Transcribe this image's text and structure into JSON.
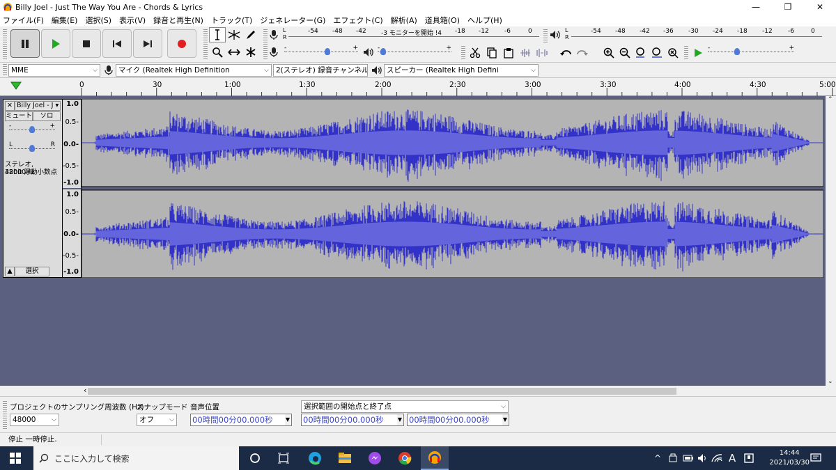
{
  "window": {
    "title": "Billy Joel - Just The Way You Are - Chords & Lyrics",
    "minimize": "—",
    "restore": "❐",
    "close": "✕"
  },
  "menu": [
    "ファイル(F)",
    "編集(E)",
    "選択(S)",
    "表示(V)",
    "録音と再生(N)",
    "トラック(T)",
    "ジェネレーター(G)",
    "エフェクト(C)",
    "解析(A)",
    "道具箱(O)",
    "ヘルプ(H)"
  ],
  "meters": {
    "record_scale": [
      "-54",
      "-48",
      "-42",
      "-3 モニターを開始 !4",
      "-18",
      "-12",
      "-6",
      "0"
    ],
    "play_scale": [
      "-54",
      "-48",
      "-42",
      "-36",
      "-30",
      "-24",
      "-18",
      "-12",
      "-6",
      "0"
    ],
    "lr": [
      "L",
      "R"
    ]
  },
  "sliders": {
    "plus": "+",
    "minus": "-"
  },
  "device": {
    "host": "MME",
    "mic": "マイク (Realtek High Definition",
    "channels": "2(ステレオ) 録音チャンネル",
    "speaker": "スピーカー (Realtek High Defini"
  },
  "ruler": [
    "0",
    "30",
    "1:00",
    "1:30",
    "2:00",
    "2:30",
    "3:00",
    "3:30",
    "4:00",
    "4:30",
    "5:00"
  ],
  "track": {
    "name": "Billy Joel - J",
    "mute": "ミュート",
    "solo": "ソロ",
    "gain_minus": "-",
    "gain_plus": "+",
    "pan_l": "L",
    "pan_r": "R",
    "info_line1": "ステレオ, 48000Hz",
    "info_line2": "32bit 浮動小数点",
    "select": "選択",
    "scale": [
      "1.0",
      "0.5-",
      "0.0-",
      "-0.5-",
      "-1.0"
    ]
  },
  "selection": {
    "rate_label": "プロジェクトのサンプリング周波数 (Hz)",
    "rate_value": "48000",
    "snap_label": "スナップモード",
    "snap_value": "オフ",
    "pos_label": "音声位置",
    "pos_value": "00時間00分00.000秒",
    "range_label": "選択範囲の開始点と終了点",
    "start_value": "00時間00分00.000秒",
    "end_value": "00時間00分00.000秒"
  },
  "status": "停止 一時停止.",
  "taskbar": {
    "search_placeholder": "ここに入力して検索",
    "time": "14:44",
    "date": "2021/03/30",
    "ime": "A"
  },
  "colors": {
    "wave": "#3232c8",
    "wave_rms": "#6464dc",
    "track_bg": "#b4b4b4",
    "workspace": "#5b5f80",
    "taskbar": "#1c2b45"
  }
}
